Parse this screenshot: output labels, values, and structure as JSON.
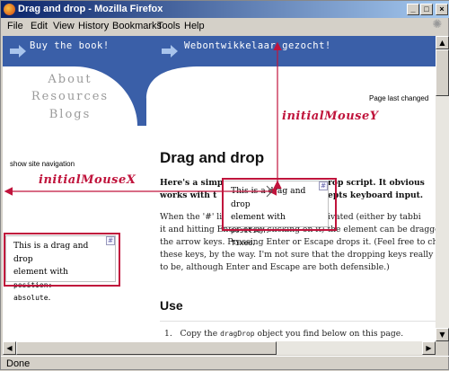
{
  "window": {
    "title": "Drag and drop - Mozilla Firefox",
    "controls": [
      "_",
      "□",
      "×"
    ]
  },
  "menu": [
    "File",
    "Edit",
    "View",
    "History",
    "Bookmarks",
    "Tools",
    "Help"
  ],
  "page": {
    "banner": {
      "left_link": "Buy the book!",
      "right_link": "Webontwikkelaar gezocht!"
    },
    "nav": [
      "About",
      "Resources",
      "Blogs"
    ],
    "last_changed": "Page last changed",
    "show_nav": "show site navigation",
    "title": "Drag and drop",
    "intro_line1": "Here's a simp",
    "intro_line1_end": "rop script. It obvious",
    "intro_line2": "works with t",
    "intro_line2_end": "epts keyboard input.",
    "para_line1": "When the '#' li",
    "para_line1_end": "ivated (either by tabbi",
    "para_line2": "it and hitting Enter or by clicking on it) the element can be dragged",
    "para_line3": "the arrow keys. Pressing Enter or Escape drops it. (Feel free to char",
    "para_line4": "these keys, by the way. I'm not sure that the dropping keys really c",
    "para_line5": "to be, although Enter and Escape are both defensible.)",
    "use_heading": "Use",
    "list_num": "1.",
    "list_pre": "Copy the ",
    "list_code": "dragDrop",
    "list_post": " object you find below on this page."
  },
  "drag_fixed": {
    "line1": "This is a drag and drop",
    "line2_pre": "element with ",
    "line2_code": "position:",
    "line3_code": "fixed",
    "line3_post": ".",
    "handle": "#"
  },
  "drag_absolute": {
    "line1": "This is a drag and drop",
    "line2_pre": "element with ",
    "line2_code": "position:",
    "line3_code": "absolute",
    "line3_post": ".",
    "handle": "#"
  },
  "annotations": {
    "x_label": "initialMouseX",
    "y_label": "initialMouseY",
    "color": "#c0143c"
  },
  "status": "Done",
  "colors": {
    "banner_blue": "#3a5fa8",
    "nav_gray": "#9a9a9a",
    "annotation_red": "#c0143c"
  }
}
